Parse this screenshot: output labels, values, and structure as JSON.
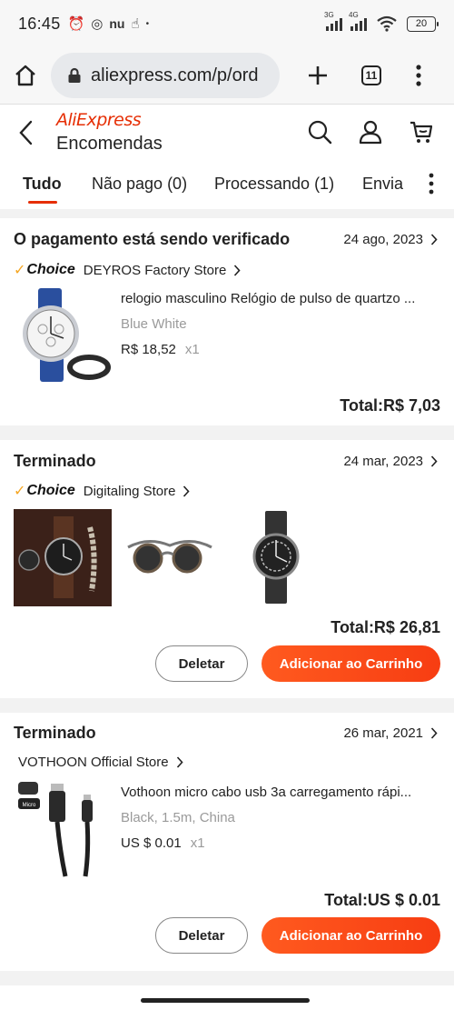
{
  "status_bar": {
    "time": "16:45",
    "net1": "3G",
    "net2": "4G",
    "battery": "20"
  },
  "browser": {
    "url": "aliexpress.com/p/ord",
    "tab_count": "11"
  },
  "header": {
    "brand": "AliExpress",
    "title": "Encomendas"
  },
  "tabs": [
    {
      "label": "Tudo"
    },
    {
      "label": "Não pago (0)"
    },
    {
      "label": "Processando (1)"
    },
    {
      "label": "Envia"
    }
  ],
  "orders": [
    {
      "status": "O pagamento está sendo verificado",
      "date": "24 ago, 2023",
      "choice_label": "Choice",
      "store": "DEYROS Factory Store",
      "product_title": "relogio masculino Relógio de pulso de quartzo ...",
      "variant": "Blue White",
      "price": "R$ 18,52",
      "qty": "x1",
      "total": "Total:R$ 7,03"
    },
    {
      "status": "Terminado",
      "date": "24 mar, 2023",
      "choice_label": "Choice",
      "store": "Digitaling Store",
      "total": "Total:R$ 26,81",
      "delete_label": "Deletar",
      "cart_label": "Adicionar ao Carrinho"
    },
    {
      "status": "Terminado",
      "date": "26 mar, 2021",
      "store": "VOTHOON Official Store",
      "product_title": "Vothoon micro cabo usb 3a carregamento rápi...",
      "variant": "Black, 1.5m, China",
      "price": "US $ 0.01",
      "qty": "x1",
      "total": "Total:US $ 0.01",
      "delete_label": "Deletar",
      "cart_label": "Adicionar ao Carrinho",
      "thumb_badge": "Micro"
    }
  ],
  "colors": {
    "accent": "#e62e04",
    "button_gradient_start": "#ff5a1f",
    "choice_tick": "#f5a623"
  }
}
